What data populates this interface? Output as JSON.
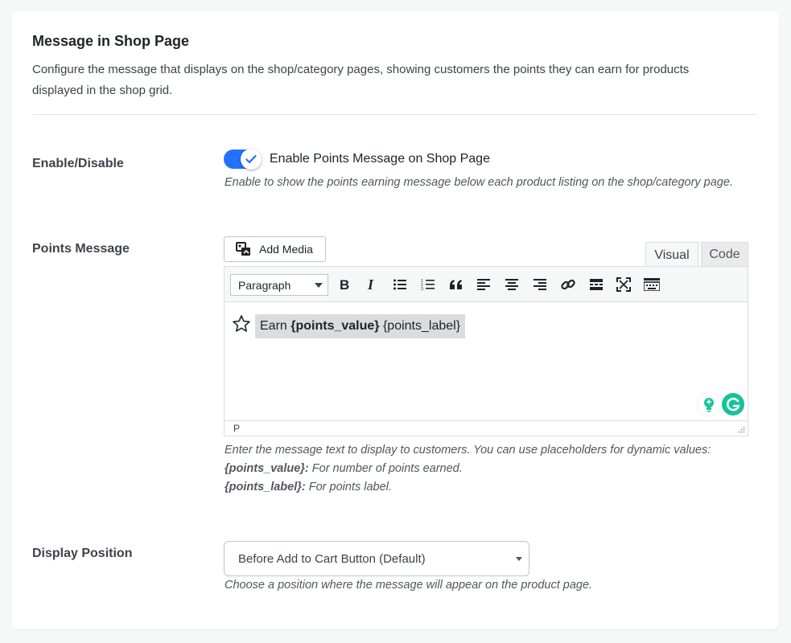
{
  "section": {
    "title": "Message in Shop Page",
    "description": "Configure the message that displays on the shop/category pages, showing customers the points they can earn for products displayed in the shop grid."
  },
  "enable": {
    "label": "Enable/Disable",
    "toggle_on": true,
    "toggle_label": "Enable Points Message on Shop Page",
    "help": "Enable to show the points earning message below each product listing on the shop/category page.",
    "accent_color": "#2271ff"
  },
  "points_message": {
    "label": "Points Message",
    "add_media": "Add Media",
    "tabs": {
      "visual": "Visual",
      "code": "Code"
    },
    "format_select": "Paragraph",
    "toolbar_icons": [
      "bold-icon",
      "italic-icon",
      "bullet-list-icon",
      "numbered-list-icon",
      "blockquote-icon",
      "align-left-icon",
      "align-center-icon",
      "align-right-icon",
      "link-icon",
      "read-more-icon",
      "fullscreen-icon",
      "toolbar-toggle-icon"
    ],
    "content": {
      "prefix": "Earn ",
      "value_placeholder": "{points_value}",
      "label_placeholder": " {points_label}"
    },
    "status_path": "P",
    "help_line1": "Enter the message text to display to customers. You can use placeholders for dynamic values:",
    "help_value_key": "{points_value}:",
    "help_value_desc": " For number of points earned.",
    "help_label_key": "{points_label}:",
    "help_label_desc": " For points label."
  },
  "display_position": {
    "label": "Display Position",
    "selected": "Before Add to Cart Button (Default)",
    "help": "Choose a position where the message will appear on the product page."
  }
}
